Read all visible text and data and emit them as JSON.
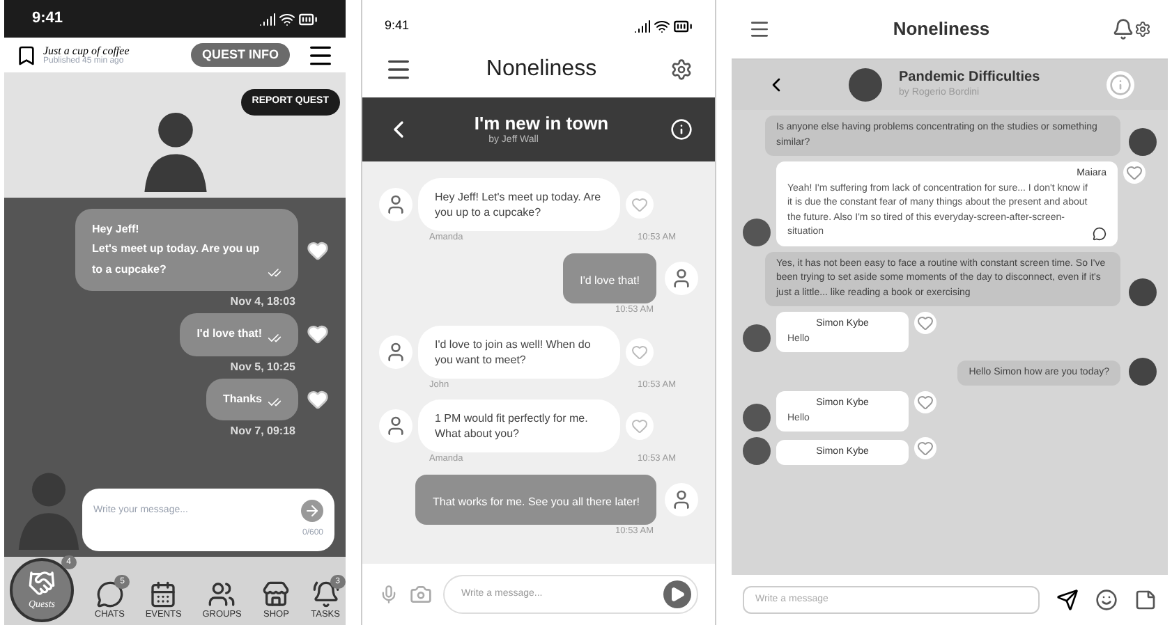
{
  "quest_screen": {
    "status_time": "9:41",
    "quest_title": "Just a cup of coffee",
    "published": "Published 45 min ago",
    "quest_info_button": "QUEST INFO",
    "report_button": "REPORT QUEST",
    "messages": [
      {
        "text": "Hey Jeff!\nLet's meet up today. Are you up to a cupcake?",
        "time": "Nov 4, 18:03"
      },
      {
        "text": "I'd love that!",
        "time": "Nov 5, 10:25"
      },
      {
        "text": "Thanks",
        "time": "Nov 7, 09:18"
      }
    ],
    "input": {
      "placeholder": "Write your message...",
      "counter": "0/600"
    },
    "nav": [
      {
        "kind": "quests",
        "label": "Quests",
        "badge": "4"
      },
      {
        "kind": "chats",
        "label": "CHATS",
        "badge": "5"
      },
      {
        "kind": "events",
        "label": "EVENTS"
      },
      {
        "kind": "groups",
        "label": "GROUPS"
      },
      {
        "kind": "shop",
        "label": "SHOP"
      },
      {
        "kind": "tasks",
        "label": "TASKS",
        "badge": "3"
      }
    ]
  },
  "town_chat": {
    "status_time": "9:41",
    "app_title": "Noneliness",
    "chat_title": "I'm new in town",
    "author": "by Jeff Wall",
    "messages": [
      {
        "own": false,
        "text": "Hey Jeff! Let's meet up today. Are you up to a cupcake?",
        "sender": "Amanda",
        "time": "10:53 AM"
      },
      {
        "own": true,
        "text": "I'd love that!",
        "time": "10:53 AM"
      },
      {
        "own": false,
        "text": "I'd love to join as well! When do you want to meet?",
        "sender": "John",
        "time": "10:53 AM"
      },
      {
        "own": false,
        "text": "1 PM would fit perfectly for me. What about you?",
        "sender": "Amanda",
        "time": "10:53 AM"
      },
      {
        "own": true,
        "text": "That works for me. See you all there later!",
        "time": "10:53 AM"
      }
    ],
    "input": {
      "placeholder": "Write a message..."
    }
  },
  "pandemic_chat": {
    "app_title": "Noneliness",
    "chat_title": "Pandemic Difficulties",
    "author": "by Rogerio Bordini",
    "messages": [
      {
        "own": true,
        "text": "Is anyone else having problems concentrating on the studies or something similar?"
      },
      {
        "own": false,
        "sender": "Maiara",
        "text": "Yeah! I'm suffering from lack of concentration for sure... I don't know if it is due the constant fear of many things about the present and about the future. Also I'm so tired of this everyday-screen-after-screen-situation",
        "emoji": true
      },
      {
        "own": true,
        "text": "Yes, it has not been easy to face a routine with constant screen time. So I've been trying to set aside some moments of the day to disconnect, even if it's just a little... like reading a book or exercising"
      },
      {
        "own": false,
        "sender": "Simon Kybe",
        "text": "Hello"
      },
      {
        "own": true,
        "text": "Hello Simon how are you today?"
      },
      {
        "own": false,
        "sender": "Simon Kybe",
        "text": "Hello"
      },
      {
        "own": false,
        "sender": "Simon Kybe"
      }
    ],
    "input": {
      "placeholder": "Write a message"
    }
  }
}
